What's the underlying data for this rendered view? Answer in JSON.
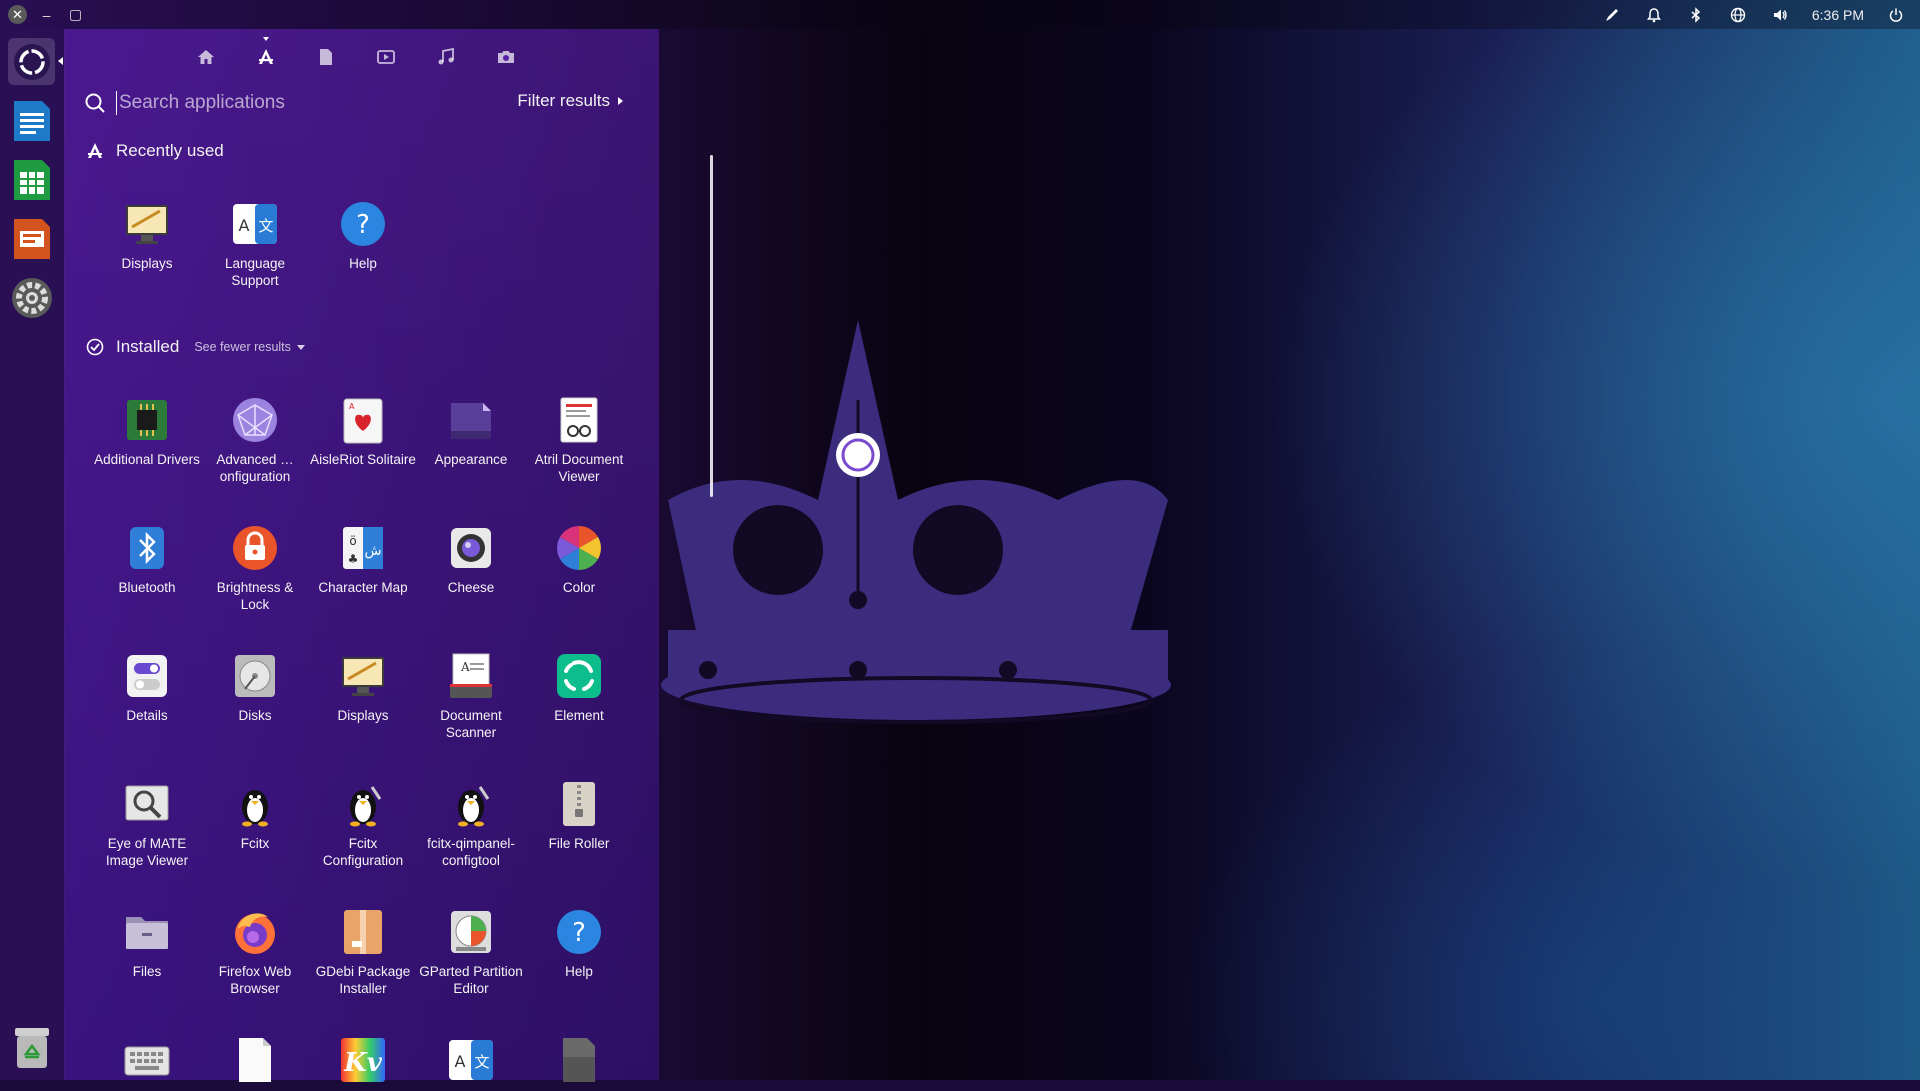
{
  "topbar": {
    "window_controls": [
      "✕",
      "–",
      "▢"
    ],
    "clock": "6:36 PM",
    "tray_icons": [
      "pen-icon",
      "bell-icon",
      "bluetooth-icon",
      "globe-icon",
      "volume-icon",
      "power-icon"
    ]
  },
  "launcher": {
    "items": [
      "dash-home-icon",
      "libreoffice-writer-icon",
      "libreoffice-calc-icon",
      "libreoffice-impress-icon",
      "settings-gear-icon",
      "trash-icon"
    ]
  },
  "dash": {
    "lenses": [
      "home-lens-icon",
      "applications-lens-icon",
      "files-lens-icon",
      "video-lens-icon",
      "music-lens-icon",
      "photo-lens-icon"
    ],
    "search": {
      "placeholder": "Search applications",
      "value": ""
    },
    "filter_label": "Filter results",
    "recent": {
      "title": "Recently used",
      "apps": [
        {
          "name": "Displays"
        },
        {
          "name": "Language Support"
        },
        {
          "name": "Help"
        }
      ]
    },
    "installed": {
      "title": "Installed",
      "see_fewer": "See fewer results",
      "apps": [
        {
          "name": "Additional Drivers"
        },
        {
          "name": "Advanced … onfiguration"
        },
        {
          "name": "AisleRiot Solitaire"
        },
        {
          "name": "Appearance"
        },
        {
          "name": "Atril Document Viewer"
        },
        {
          "name": "Bluetooth"
        },
        {
          "name": "Brightness & Lock"
        },
        {
          "name": "Character Map"
        },
        {
          "name": "Cheese"
        },
        {
          "name": "Color"
        },
        {
          "name": "Details"
        },
        {
          "name": "Disks"
        },
        {
          "name": "Displays"
        },
        {
          "name": "Document Scanner"
        },
        {
          "name": "Element"
        },
        {
          "name": "Eye of MATE Image Viewer"
        },
        {
          "name": "Fcitx"
        },
        {
          "name": "Fcitx Configuration"
        },
        {
          "name": "fcitx-qimpanel-configtool"
        },
        {
          "name": "File Roller"
        },
        {
          "name": "Files"
        },
        {
          "name": "Firefox Web Browser"
        },
        {
          "name": "GDebi Package Installer"
        },
        {
          "name": "GParted Partition Editor"
        },
        {
          "name": "Help"
        },
        {
          "name": ""
        },
        {
          "name": ""
        },
        {
          "name": ""
        },
        {
          "name": ""
        },
        {
          "name": ""
        }
      ]
    }
  },
  "colors": {
    "accent": "#e95420",
    "dash_bg": "#5a1eaa",
    "crown": "#3a2a7a"
  }
}
